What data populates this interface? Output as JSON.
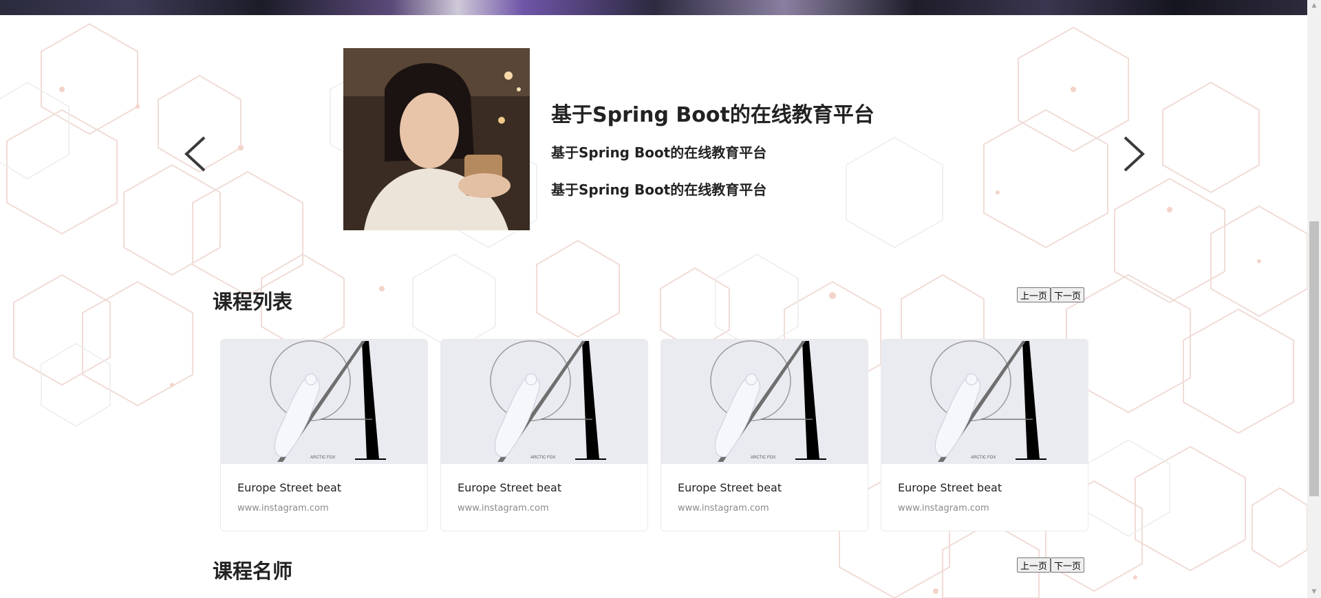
{
  "carousel": {
    "title": "基于Spring Boot的在线教育平台",
    "lines": [
      "基于Spring Boot的在线教育平台",
      "基于Spring Boot的在线教育平台"
    ],
    "prev_icon": "chevron-left-icon",
    "next_icon": "chevron-right-icon"
  },
  "courses": {
    "title": "课程列表",
    "prev_label": "上一页",
    "next_label": "下一页",
    "items": [
      {
        "title": "Europe Street beat",
        "subtitle": "www.instagram.com",
        "cover_caption": "ARCTIC FOX"
      },
      {
        "title": "Europe Street beat",
        "subtitle": "www.instagram.com",
        "cover_caption": "ARCTIC FOX"
      },
      {
        "title": "Europe Street beat",
        "subtitle": "www.instagram.com",
        "cover_caption": "ARCTIC FOX"
      },
      {
        "title": "Europe Street beat",
        "subtitle": "www.instagram.com",
        "cover_caption": "ARCTIC FOX"
      }
    ]
  },
  "teachers": {
    "title": "课程名师",
    "prev_label": "上一页",
    "next_label": "下一页"
  },
  "colors": {
    "background": "#ffffff",
    "card_cover": "#e9ebf0",
    "hexagon_pattern": "#f1d9d2",
    "text": "#222222",
    "muted_text": "#8a8a8a"
  }
}
